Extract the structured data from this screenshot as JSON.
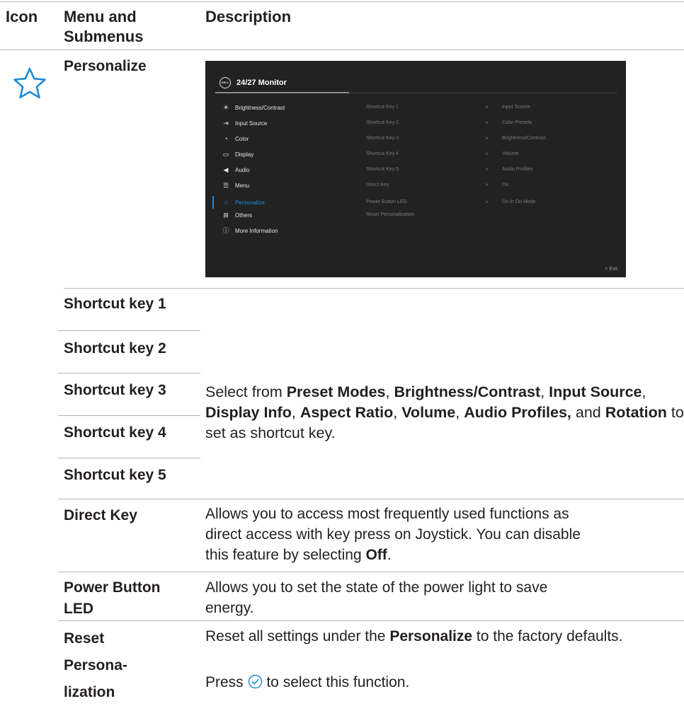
{
  "header": {
    "col_icon": "Icon",
    "col_menu": "Menu and Submenus",
    "col_desc": "Description"
  },
  "section": {
    "title": "Personalize",
    "icon": "star-outline-icon"
  },
  "osd": {
    "logo_text": "DELL",
    "title": "24/27 Monitor",
    "menu": [
      {
        "label": "Brightness/Contrast",
        "icon": "sun-icon"
      },
      {
        "label": "Input Source",
        "icon": "input-icon"
      },
      {
        "label": "Color",
        "icon": "palette-icon"
      },
      {
        "label": "Display",
        "icon": "monitor-icon"
      },
      {
        "label": "Audio",
        "icon": "speaker-icon"
      },
      {
        "label": "Menu",
        "icon": "menu-icon"
      },
      {
        "label": "Personalize",
        "icon": "star-icon",
        "active": true
      },
      {
        "label": "Others",
        "icon": "others-icon"
      },
      {
        "label": "More Information",
        "icon": "info-icon"
      }
    ],
    "submenu": [
      {
        "label": "Shortcut Key 1",
        "value": "Input Source"
      },
      {
        "label": "Shortcut Key 2",
        "value": "Color Presets"
      },
      {
        "label": "Shortcut Key 3",
        "value": "Brightness/Contrast"
      },
      {
        "label": "Shortcut Key 4",
        "value": "Volume"
      },
      {
        "label": "Shortcut Key 5",
        "value": "Audio Profiles"
      },
      {
        "label": "Direct Key",
        "value": "On"
      },
      {
        "label": "Power Button LED",
        "value": "On in On Mode"
      },
      {
        "label": "Reset Personalization",
        "value": ""
      }
    ],
    "arrow": ">",
    "exit": "<  Exit"
  },
  "rows": {
    "shortcut_keys": [
      "Shortcut key 1",
      "Shortcut key 2",
      "Shortcut key 3",
      "Shortcut key 4",
      "Shortcut key 5"
    ],
    "shortcut_desc": {
      "p1": "Select from ",
      "b1": "Preset Modes",
      "p2": ", ",
      "b2": "Brightness/Contrast",
      "p3": ", ",
      "b3": "Input Source",
      "p4": ", ",
      "b4": "Display Info",
      "p5": ", ",
      "b5": "Aspect Ratio",
      "p6": ", ",
      "b6": "Volume",
      "p7": ", ",
      "b7": "Audio Profiles,",
      "p8": " and ",
      "b8": "Rotation",
      "p9": " to set as shortcut key."
    },
    "direct_key": {
      "label": "Direct Key",
      "text": "Allows you to access most frequently used functions as direct access with key press on Joystick. You can disable this feature by selecting ",
      "bold": "Off",
      "end": "."
    },
    "power_led": {
      "label_1": "Power Button",
      "label_2": "LED",
      "text": "Allows you to set the state of the power light to save energy."
    },
    "reset": {
      "label_1": "Reset",
      "label_2": "Persona-",
      "label_3": "lization",
      "t1": "Reset all settings under the ",
      "b1": "Personalize",
      "t2": " to the factory defaults.",
      "press_1": "Press ",
      "press_2": " to select this function."
    }
  },
  "colors": {
    "rule": "#b4b4b4",
    "accent": "#1d8bd7",
    "osd_bg": "#222222"
  }
}
